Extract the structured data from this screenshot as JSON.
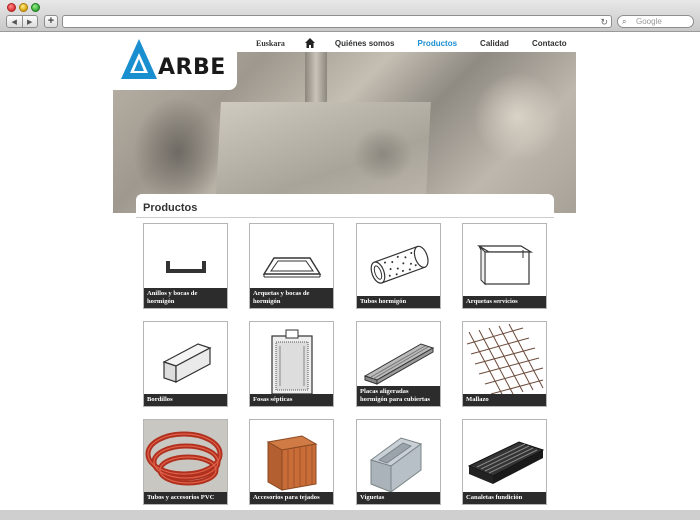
{
  "browser": {
    "back_icon": "back-arrow-icon",
    "forward_icon": "forward-arrow-icon",
    "new_tab_label": "+",
    "reload_icon": "reload-icon",
    "search_placeholder": "Google"
  },
  "site": {
    "logo_text": "ARBE",
    "brand_color": "#1a8fd0"
  },
  "nav": {
    "language": "Euskara",
    "home_icon": "home-icon",
    "items": [
      {
        "label": "Quiénes somos"
      },
      {
        "label": "Productos",
        "active": true
      },
      {
        "label": "Calidad"
      },
      {
        "label": "Contacto"
      }
    ]
  },
  "section": {
    "title": "Productos"
  },
  "products": [
    {
      "name": "Anillos y bocas de hormigón",
      "icon": "u-channel-icon"
    },
    {
      "name": "Arquetas y bocas de hormigón",
      "icon": "frame-icon"
    },
    {
      "name": "Tubos hormigón",
      "icon": "tube-icon"
    },
    {
      "name": "Arquetas servicios",
      "icon": "box-icon"
    },
    {
      "name": "Bordillos",
      "icon": "curb-icon"
    },
    {
      "name": "Fosas sépticas",
      "icon": "septic-tank-icon"
    },
    {
      "name": "Placas aligeradas hormigón para cubiertas",
      "icon": "slab-icon"
    },
    {
      "name": "Mallazo",
      "icon": "mesh-icon"
    },
    {
      "name": "Tubos y accesorios PVC",
      "icon": "pvc-tube-icon"
    },
    {
      "name": "Accesorios para tejados",
      "icon": "brick-icon"
    },
    {
      "name": "Viguetas",
      "icon": "beam-icon"
    },
    {
      "name": "Canaletas fundición",
      "icon": "drain-channel-icon"
    }
  ]
}
